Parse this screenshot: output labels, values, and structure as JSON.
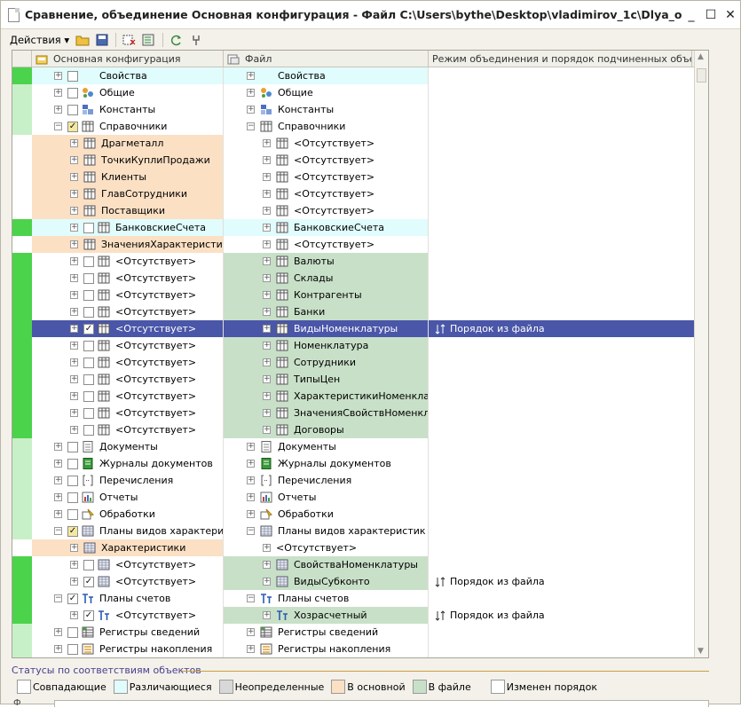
{
  "window": {
    "title": "Сравнение, объединение Основная конфигурация - Файл C:\\Users\\bythe\\Desktop\\vladimirov_1c\\Dlya_obedineniya.cf",
    "minimize": "_",
    "maximize": "☐",
    "close": "✕"
  },
  "toolbar": {
    "actions_label": "Действия ▾"
  },
  "columns": {
    "main": "Основная конфигурация",
    "file": "Файл",
    "mode": "Режим объединения и порядок подчиненных объе..."
  },
  "rows": [
    {
      "c0": "#4cd34c",
      "ind1": 0,
      "exp1": "+",
      "chk": "",
      "icon": "props",
      "t1": "Свойства",
      "bg1": "#e0fcfc",
      "ind2": 0,
      "exp2": "+",
      "icon2": "props",
      "t2": "Свойства",
      "bg2": "#e0fcfc",
      "mode": ""
    },
    {
      "c0": "#c8f0c8",
      "ind1": 0,
      "exp1": "+",
      "chk": "",
      "icon": "common",
      "t1": "Общие",
      "bg1": "",
      "ind2": 0,
      "exp2": "+",
      "icon2": "common",
      "t2": "Общие",
      "bg2": "",
      "mode": ""
    },
    {
      "c0": "#c8f0c8",
      "ind1": 0,
      "exp1": "+",
      "chk": "",
      "icon": "const",
      "t1": "Константы",
      "bg1": "",
      "ind2": 0,
      "exp2": "+",
      "icon2": "const",
      "t2": "Константы",
      "bg2": "",
      "mode": ""
    },
    {
      "c0": "#c8f0c8",
      "ind1": 0,
      "exp1": "−",
      "chk": "✓",
      "chkbg": "#f4e8a0",
      "icon": "table",
      "t1": "Справочники",
      "bg1": "",
      "ind2": 0,
      "exp2": "−",
      "icon2": "table",
      "t2": "Справочники",
      "bg2": "",
      "mode": ""
    },
    {
      "c0": "",
      "ind1": 1,
      "exp1": "+",
      "chk": null,
      "icon": "table",
      "t1": "Драгметалл",
      "bg1": "#fbe0c4",
      "ind2": 1,
      "exp2": "+",
      "icon2": "table",
      "t2": "<Отсутствует>",
      "bg2": "",
      "mode": ""
    },
    {
      "c0": "",
      "ind1": 1,
      "exp1": "+",
      "chk": null,
      "icon": "table",
      "t1": "ТочкиКуплиПродажи",
      "bg1": "#fbe0c4",
      "ind2": 1,
      "exp2": "+",
      "icon2": "table",
      "t2": "<Отсутствует>",
      "bg2": "",
      "mode": ""
    },
    {
      "c0": "",
      "ind1": 1,
      "exp1": "+",
      "chk": null,
      "icon": "table",
      "t1": "Клиенты",
      "bg1": "#fbe0c4",
      "ind2": 1,
      "exp2": "+",
      "icon2": "table",
      "t2": "<Отсутствует>",
      "bg2": "",
      "mode": ""
    },
    {
      "c0": "",
      "ind1": 1,
      "exp1": "+",
      "chk": null,
      "icon": "table",
      "t1": "ГлавСотрудники",
      "bg1": "#fbe0c4",
      "ind2": 1,
      "exp2": "+",
      "icon2": "table",
      "t2": "<Отсутствует>",
      "bg2": "",
      "mode": ""
    },
    {
      "c0": "",
      "ind1": 1,
      "exp1": "+",
      "chk": null,
      "icon": "table",
      "t1": "Поставщики",
      "bg1": "#fbe0c4",
      "ind2": 1,
      "exp2": "+",
      "icon2": "table",
      "t2": "<Отсутствует>",
      "bg2": "",
      "mode": ""
    },
    {
      "c0": "#4cd34c",
      "ind1": 1,
      "exp1": "+",
      "chk": "",
      "icon": "table",
      "t1": "БанковскиеСчета",
      "bg1": "#e0fcfc",
      "ind2": 1,
      "exp2": "+",
      "icon2": "table",
      "t2": "БанковскиеСчета",
      "bg2": "#e0fcfc",
      "mode": ""
    },
    {
      "c0": "",
      "ind1": 1,
      "exp1": "+",
      "chk": null,
      "icon": "table",
      "t1": "ЗначенияХарактеристик",
      "bg1": "#fbe0c4",
      "ind2": 1,
      "exp2": "+",
      "icon2": "table",
      "t2": "<Отсутствует>",
      "bg2": "",
      "mode": ""
    },
    {
      "c0": "#4cd34c",
      "ind1": 1,
      "exp1": "+",
      "chk": "",
      "icon": "table",
      "t1": "<Отсутствует>",
      "bg1": "",
      "ind2": 1,
      "exp2": "+",
      "icon2": "table",
      "t2": "Валюты",
      "bg2": "#c8e0c8",
      "mode": ""
    },
    {
      "c0": "#4cd34c",
      "ind1": 1,
      "exp1": "+",
      "chk": "",
      "icon": "table",
      "t1": "<Отсутствует>",
      "bg1": "",
      "ind2": 1,
      "exp2": "+",
      "icon2": "table",
      "t2": "Склады",
      "bg2": "#c8e0c8",
      "mode": ""
    },
    {
      "c0": "#4cd34c",
      "ind1": 1,
      "exp1": "+",
      "chk": "",
      "icon": "table",
      "t1": "<Отсутствует>",
      "bg1": "",
      "ind2": 1,
      "exp2": "+",
      "icon2": "table",
      "t2": "Контрагенты",
      "bg2": "#c8e0c8",
      "mode": ""
    },
    {
      "c0": "#4cd34c",
      "ind1": 1,
      "exp1": "+",
      "chk": "",
      "icon": "table",
      "t1": "<Отсутствует>",
      "bg1": "",
      "ind2": 1,
      "exp2": "+",
      "icon2": "table",
      "t2": "Банки",
      "bg2": "#c8e0c8",
      "mode": ""
    },
    {
      "c0": "#4cd34c",
      "ind1": 1,
      "exp1": "+",
      "chk": "✓",
      "icon": "table",
      "t1": "<Отсутствует>",
      "bg1": "",
      "ind2": 1,
      "exp2": "+",
      "icon2": "table",
      "t2": "ВидыНоменклатуры",
      "bg2": "",
      "mode": "Порядок из файла",
      "sel": true
    },
    {
      "c0": "#4cd34c",
      "ind1": 1,
      "exp1": "+",
      "chk": "",
      "icon": "table",
      "t1": "<Отсутствует>",
      "bg1": "",
      "ind2": 1,
      "exp2": "+",
      "icon2": "table",
      "t2": "Номенклатура",
      "bg2": "#c8e0c8",
      "mode": ""
    },
    {
      "c0": "#4cd34c",
      "ind1": 1,
      "exp1": "+",
      "chk": "",
      "icon": "table",
      "t1": "<Отсутствует>",
      "bg1": "",
      "ind2": 1,
      "exp2": "+",
      "icon2": "table",
      "t2": "Сотрудники",
      "bg2": "#c8e0c8",
      "mode": ""
    },
    {
      "c0": "#4cd34c",
      "ind1": 1,
      "exp1": "+",
      "chk": "",
      "icon": "table",
      "t1": "<Отсутствует>",
      "bg1": "",
      "ind2": 1,
      "exp2": "+",
      "icon2": "table",
      "t2": "ТипыЦен",
      "bg2": "#c8e0c8",
      "mode": ""
    },
    {
      "c0": "#4cd34c",
      "ind1": 1,
      "exp1": "+",
      "chk": "",
      "icon": "table",
      "t1": "<Отсутствует>",
      "bg1": "",
      "ind2": 1,
      "exp2": "+",
      "icon2": "table",
      "t2": "ХарактеристикиНоменкла...",
      "bg2": "#c8e0c8",
      "mode": ""
    },
    {
      "c0": "#4cd34c",
      "ind1": 1,
      "exp1": "+",
      "chk": "",
      "icon": "table",
      "t1": "<Отсутствует>",
      "bg1": "",
      "ind2": 1,
      "exp2": "+",
      "icon2": "table",
      "t2": "ЗначенияСвойствНоменкл...",
      "bg2": "#c8e0c8",
      "mode": ""
    },
    {
      "c0": "#4cd34c",
      "ind1": 1,
      "exp1": "+",
      "chk": "",
      "icon": "table",
      "t1": "<Отсутствует>",
      "bg1": "",
      "ind2": 1,
      "exp2": "+",
      "icon2": "table",
      "t2": "Договоры",
      "bg2": "#c8e0c8",
      "mode": ""
    },
    {
      "c0": "#c8f0c8",
      "ind1": 0,
      "exp1": "+",
      "chk": "",
      "icon": "docs",
      "t1": "Документы",
      "bg1": "",
      "ind2": 0,
      "exp2": "+",
      "icon2": "docs",
      "t2": "Документы",
      "bg2": "",
      "mode": ""
    },
    {
      "c0": "#c8f0c8",
      "ind1": 0,
      "exp1": "+",
      "chk": "",
      "icon": "journal",
      "t1": "Журналы документов",
      "bg1": "",
      "ind2": 0,
      "exp2": "+",
      "icon2": "journal",
      "t2": "Журналы документов",
      "bg2": "",
      "mode": ""
    },
    {
      "c0": "#c8f0c8",
      "ind1": 0,
      "exp1": "+",
      "chk": "",
      "icon": "enum",
      "t1": "Перечисления",
      "bg1": "",
      "ind2": 0,
      "exp2": "+",
      "icon2": "enum",
      "t2": "Перечисления",
      "bg2": "",
      "mode": ""
    },
    {
      "c0": "#c8f0c8",
      "ind1": 0,
      "exp1": "+",
      "chk": "",
      "icon": "report",
      "t1": "Отчеты",
      "bg1": "",
      "ind2": 0,
      "exp2": "+",
      "icon2": "report",
      "t2": "Отчеты",
      "bg2": "",
      "mode": ""
    },
    {
      "c0": "#c8f0c8",
      "ind1": 0,
      "exp1": "+",
      "chk": "",
      "icon": "proc",
      "t1": "Обработки",
      "bg1": "",
      "ind2": 0,
      "exp2": "+",
      "icon2": "proc",
      "t2": "Обработки",
      "bg2": "",
      "mode": ""
    },
    {
      "c0": "#c8f0c8",
      "ind1": 0,
      "exp1": "−",
      "chk": "✓",
      "chkbg": "#f4e8a0",
      "icon": "chart",
      "t1": "Планы видов характери...",
      "bg1": "",
      "ind2": 0,
      "exp2": "−",
      "icon2": "chart",
      "t2": "Планы видов характеристик",
      "bg2": "",
      "mode": ""
    },
    {
      "c0": "",
      "ind1": 1,
      "exp1": "+",
      "chk": null,
      "icon": "chart",
      "t1": "Характеристики",
      "bg1": "#fbe0c4",
      "ind2": 1,
      "exp2": "+",
      "icon2": "",
      "t2": "<Отсутствует>",
      "bg2": "",
      "mode": ""
    },
    {
      "c0": "#4cd34c",
      "ind1": 1,
      "exp1": "+",
      "chk": "",
      "icon": "chart",
      "t1": "<Отсутствует>",
      "bg1": "",
      "ind2": 1,
      "exp2": "+",
      "icon2": "chart",
      "t2": "СвойстваНоменклатуры",
      "bg2": "#c8e0c8",
      "mode": ""
    },
    {
      "c0": "#4cd34c",
      "ind1": 1,
      "exp1": "+",
      "chk": "✓",
      "icon": "chart",
      "t1": "<Отсутствует>",
      "bg1": "",
      "ind2": 1,
      "exp2": "+",
      "icon2": "chart",
      "t2": "ВидыСубконто",
      "bg2": "#c8e0c8",
      "mode": "Порядок из файла"
    },
    {
      "c0": "#4cd34c",
      "ind1": 0,
      "exp1": "−",
      "chk": "✓",
      "icon": "acc",
      "t1": "Планы счетов",
      "bg1": "",
      "ind2": 0,
      "exp2": "−",
      "icon2": "acc",
      "t2": "Планы счетов",
      "bg2": "",
      "mode": ""
    },
    {
      "c0": "#4cd34c",
      "ind1": 1,
      "exp1": "+",
      "chk": "✓",
      "icon": "acc",
      "t1": "<Отсутствует>",
      "bg1": "",
      "ind2": 1,
      "exp2": "+",
      "icon2": "acc",
      "t2": "Хозрасчетный",
      "bg2": "#c8e0c8",
      "mode": "Порядок из файла"
    },
    {
      "c0": "#c8f0c8",
      "ind1": 0,
      "exp1": "+",
      "chk": "",
      "icon": "reg",
      "t1": "Регистры сведений",
      "bg1": "",
      "ind2": 0,
      "exp2": "+",
      "icon2": "reg",
      "t2": "Регистры сведений",
      "bg2": "",
      "mode": ""
    },
    {
      "c0": "#c8f0c8",
      "ind1": 0,
      "exp1": "+",
      "chk": "",
      "icon": "acc-reg",
      "t1": "Регистры накопления",
      "bg1": "",
      "ind2": 0,
      "exp2": "+",
      "icon2": "acc-reg",
      "t2": "Регистры накопления",
      "bg2": "",
      "mode": ""
    }
  ],
  "legend": {
    "title": "Статусы по соответствиям объектов",
    "items": [
      {
        "label": "Совпадающие",
        "color": "#ffffff"
      },
      {
        "label": "Различающиеся",
        "color": "#e0fcfc"
      },
      {
        "label": "Неопределенные",
        "color": "#d8d8d8"
      },
      {
        "label": "В основной",
        "color": "#fbe0c4"
      },
      {
        "label": "В файле",
        "color": "#c8e0c8"
      },
      {
        "label": "Изменен порядок",
        "color": "#ffffff"
      }
    ]
  },
  "bottom": {
    "label": "Ф"
  }
}
